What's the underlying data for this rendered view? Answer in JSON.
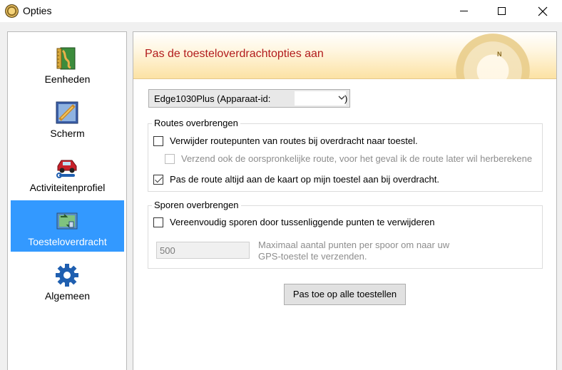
{
  "window": {
    "title": "Opties"
  },
  "sidebar": {
    "items": [
      {
        "label": "Eenheden",
        "icon": "ruler-map-icon",
        "active": false
      },
      {
        "label": "Scherm",
        "icon": "display-settings-icon",
        "active": false
      },
      {
        "label": "Activiteitenprofiel",
        "icon": "car-wrench-icon",
        "active": false
      },
      {
        "label": "Toesteloverdracht",
        "icon": "device-transfer-icon",
        "active": true
      },
      {
        "label": "Algemeen",
        "icon": "gear-icon",
        "active": false
      }
    ]
  },
  "panel": {
    "title": "Pas de toesteloverdrachtopties aan",
    "device_select": {
      "value": "Edge1030Plus (Apparaat-id:",
      "value_suffix": ")"
    },
    "routes_group": {
      "title": "Routes overbrengen",
      "options": [
        {
          "label": "Verwijder routepunten van routes bij overdracht naar toestel.",
          "checked": false,
          "enabled": true
        },
        {
          "label": "Verzend ook de oorspronkelijke route, voor het geval ik de route later wil herberekene",
          "checked": false,
          "enabled": false
        },
        {
          "label": "Pas de route altijd aan de kaart op mijn toestel aan bij overdracht.",
          "checked": true,
          "enabled": true
        }
      ]
    },
    "tracks_group": {
      "title": "Sporen overbrengen",
      "options": [
        {
          "label": "Vereenvoudig sporen door tussenliggende punten te verwijderen",
          "checked": false,
          "enabled": true
        }
      ],
      "max_points_value": "500",
      "max_points_hint": "Maximaal aantal punten per spoor om naar uw GPS-toestel te verzenden."
    },
    "apply_button": "Pas toe op alle toestellen"
  },
  "colors": {
    "accent": "#3399ff",
    "banner_title": "#b21c1c"
  }
}
